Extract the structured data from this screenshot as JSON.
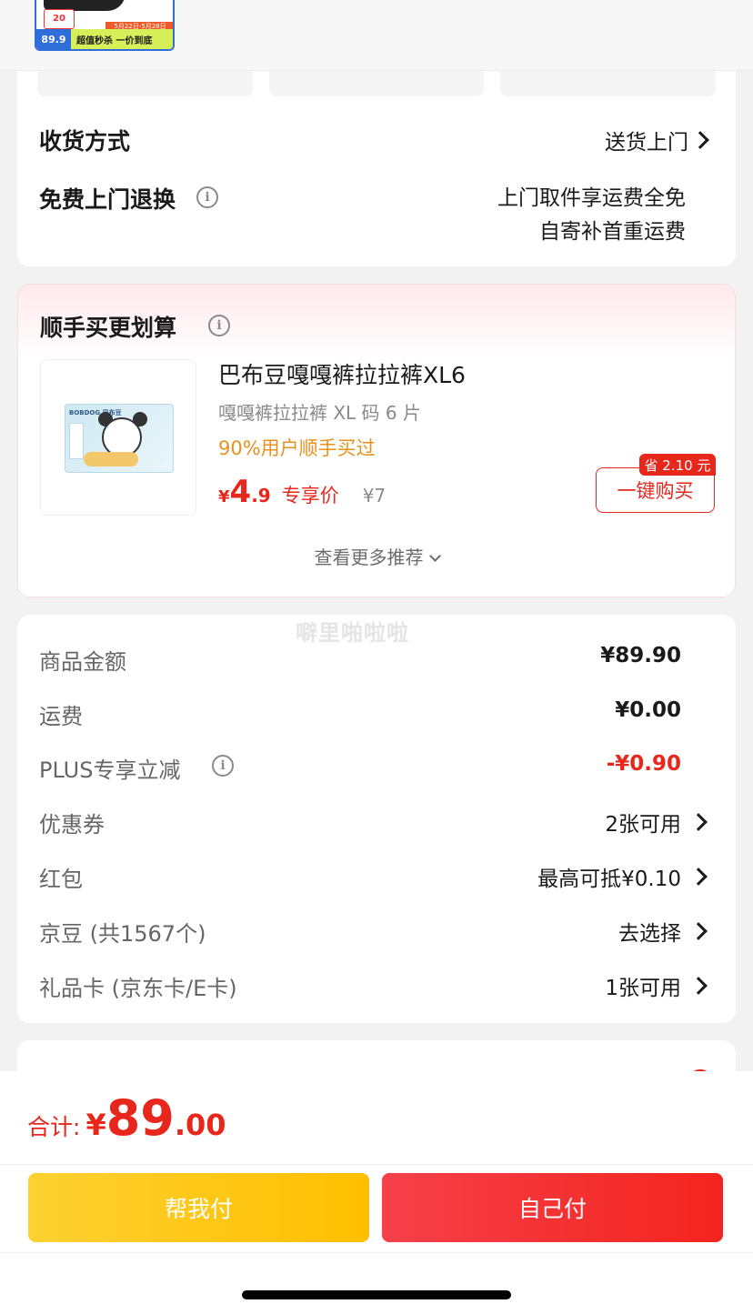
{
  "promo": {
    "badge": "20",
    "date_tag": "5月22日-5月28日",
    "price": "89.9",
    "slogan": "超值秒杀 一价到底"
  },
  "delivery": {
    "method_label": "收货方式",
    "method_value": "送货上门",
    "return_label": "免费上门退换",
    "return_line1": "上门取件享运费全免",
    "return_line2": "自寄补首重运费"
  },
  "recommend": {
    "title": "顺手买更划算",
    "product": {
      "name": "巴布豆嘎嘎裤拉拉裤XL6",
      "spec": "嘎嘎裤拉拉裤 XL 码 6 片",
      "buy_rate": "90%用户顺手买过",
      "price_symbol": "¥",
      "price_int": "4",
      "price_dec": ".9",
      "price_tag": "专享价",
      "orig_price": "¥7",
      "save_badge": "省 2.10 元",
      "buy_button": "一键购买",
      "brand_text": "BOBDOG 巴布豆"
    },
    "more_link": "查看更多推荐"
  },
  "price_breakdown": {
    "watermark": "噼里啪啦啦",
    "rows": [
      {
        "label": "商品金额",
        "value": "¥89.90"
      },
      {
        "label": "运费",
        "value": "¥0.00"
      },
      {
        "label": "PLUS专享立减",
        "value": "-¥0.90"
      },
      {
        "label": "优惠券",
        "value": "2张可用"
      },
      {
        "label": "红包",
        "value": "最高可抵¥0.10"
      },
      {
        "label": "京豆 (共1567个)",
        "value": "去选择"
      },
      {
        "label": "礼品卡 (京东卡/E卡)",
        "value": "1张可用"
      }
    ]
  },
  "footer": {
    "total_label": "合计:",
    "total_yen": "¥",
    "total_int": "89",
    "total_dec": ".00",
    "help_pay": "帮我付",
    "self_pay": "自己付"
  },
  "colors": {
    "accent_red": "#e8271c",
    "orange": "#e7911f",
    "yellow": "#ffbf00"
  }
}
